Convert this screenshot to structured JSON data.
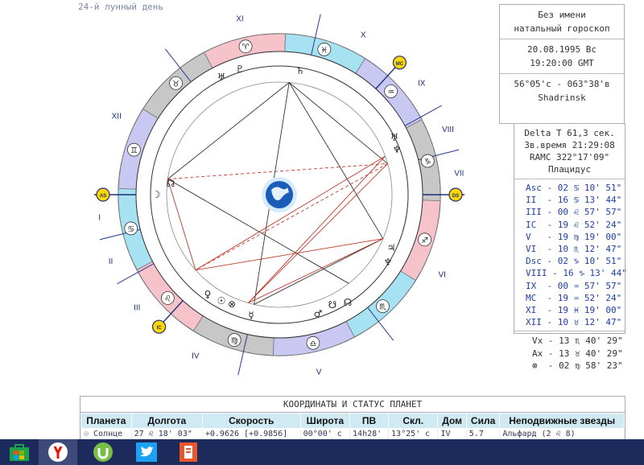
{
  "moon_day": "24-й лунный день",
  "info": {
    "name": "Без имени",
    "type": "натальный гороскоп",
    "date": "20.08.1995 Вс",
    "time": "19:20:00 GMT",
    "coords": "56°05'с - 063°38'в",
    "place": "Shadrinsk"
  },
  "params": {
    "delta_t": "Delta T  61,3 сек.",
    "star_time": "Зв.время 21:29:08",
    "ramc": "RAMC 322°17'09\"",
    "system": "Плацидус"
  },
  "cusps": [
    "Asc - 02 ♋ 10' 51\"",
    "II  - 16 ♋ 13' 44\"",
    "III - 00 ♌ 57' 57\"",
    "IC  - 19 ♌ 52' 24\"",
    "V   - 19 ♍ 19' 00\"",
    "VI  - 10 ♏ 12' 47\"",
    "Dsc - 02 ♑ 10' 51\"",
    "VIII - 16 ♑ 13' 44\"",
    "IX  - 00 ♒ 57' 57\"",
    "MC  - 19 ♒ 52' 24\"",
    "XI  - 19 ♓ 19' 00\"",
    "XII - 10 ♉ 12' 47\""
  ],
  "extra_points": [
    "Vx - 13 ♏ 40' 29\"",
    "Ax - 13 ♉ 40' 29\"",
    "⊗  - 02 ♍ 58' 23\""
  ],
  "chart_labels": {
    "houses": [
      "I",
      "II",
      "III",
      "IV",
      "V",
      "VI",
      "VII",
      "VIII",
      "IX",
      "X",
      "XI",
      "XII"
    ],
    "asc": "AS",
    "dsc": "DS",
    "mc": "MC",
    "ic": "IC"
  },
  "table": {
    "title": "КООРДИНАТЫ И СТАТУС ПЛАНЕТ",
    "headers": [
      "Планета",
      "Долгота",
      "Скорость",
      "Широта",
      "ПВ",
      "Скл.",
      "Дом",
      "Сила",
      "Неподвижные звезды"
    ],
    "row": [
      "☉ Солнце",
      "27 ♌ 18' 03\"",
      "+0.9626 [+0.9856]",
      "00°00' с",
      "14h28'",
      "13°25' с",
      "IV",
      "5.7",
      "Альфард (2 ♌ 8)"
    ]
  },
  "taskbar": {
    "items": [
      "windows-store",
      "yandex-browser",
      "utorrent",
      "twitter",
      "office-app"
    ]
  },
  "colors": {
    "water": "#a7e2f2",
    "fire": "#f6c3ca",
    "earth": "#c7c7c7",
    "air": "#c8c8f2",
    "aspect_red": "#c0392b",
    "aspect_dark": "#444444",
    "taskbar": "#1d2a5c"
  }
}
